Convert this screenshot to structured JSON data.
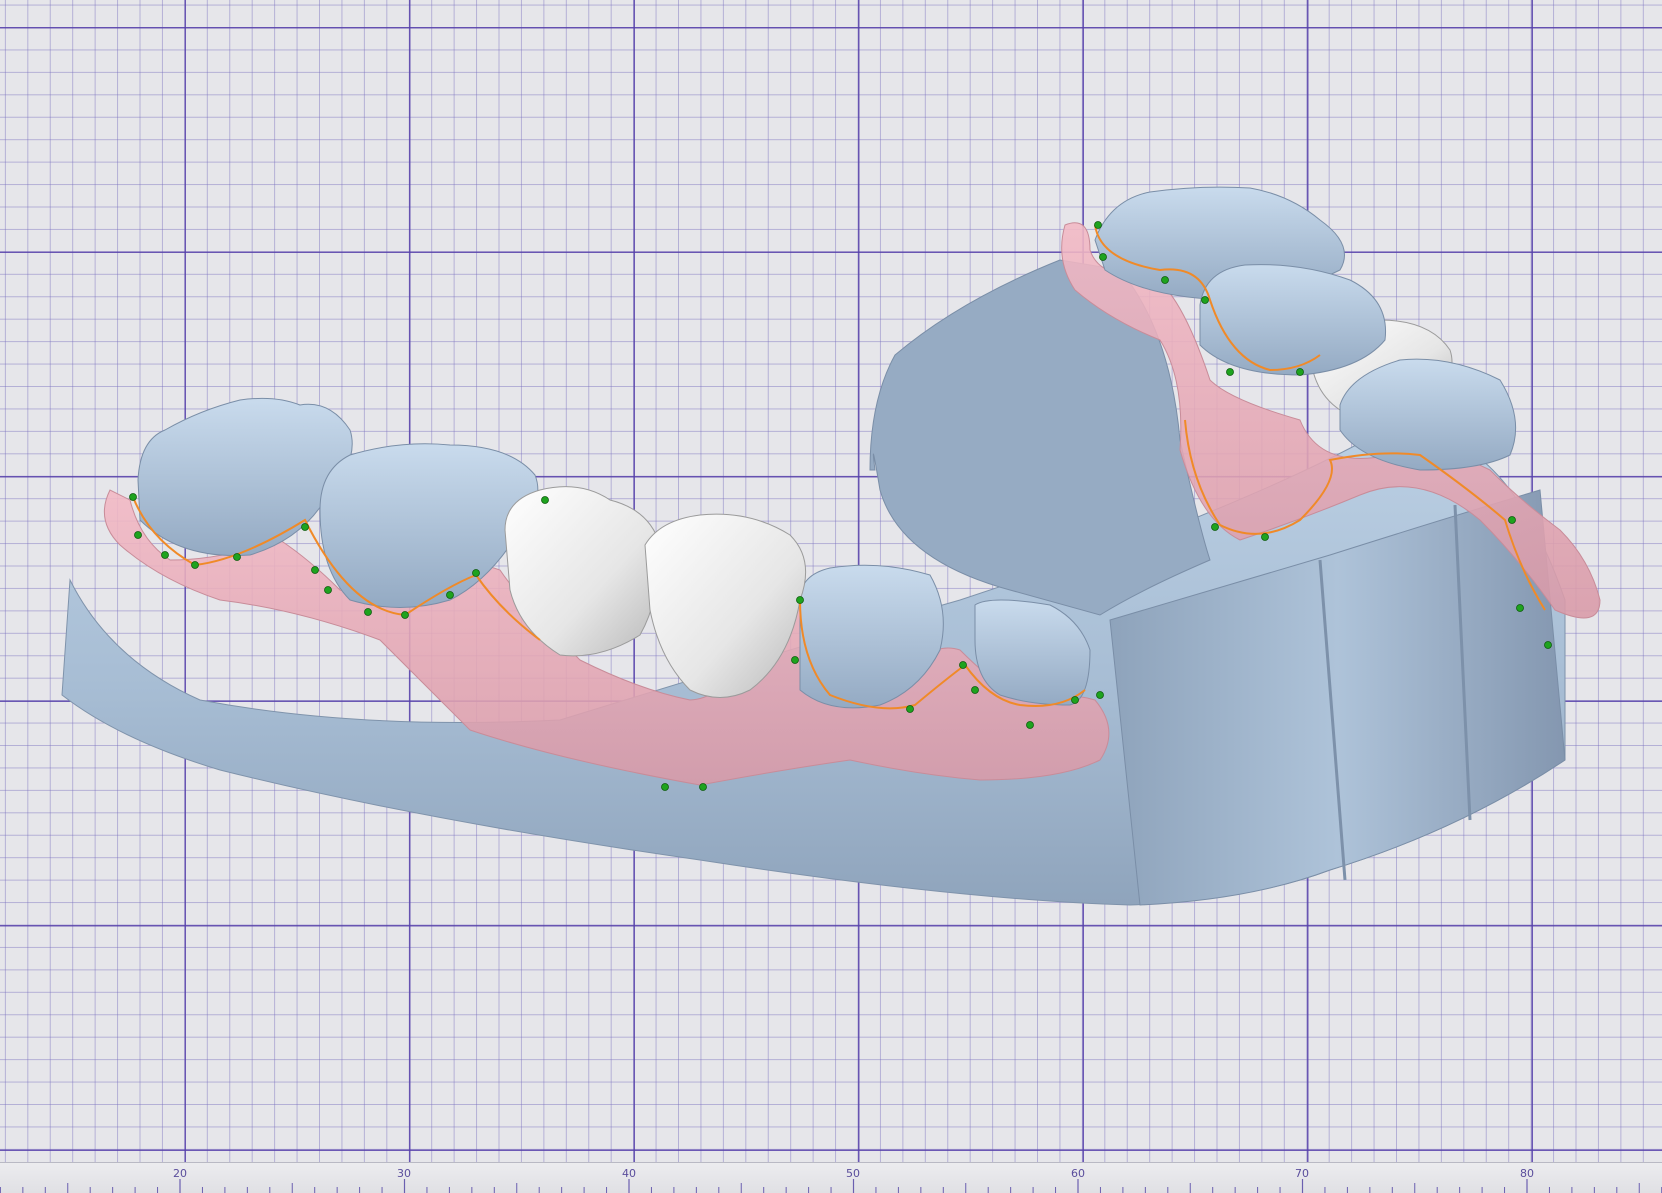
{
  "viewport": {
    "grid_color": "#5a40aa",
    "background": "#e6e6ea"
  },
  "model": {
    "colors": {
      "stone_model": "#a9bfd6",
      "stone_shadow": "#7f93ab",
      "crown_white": "#f1f1f1",
      "gingiva_pink": "#e7a6b4",
      "margin_line": "#f08a28",
      "control_point": "#1ea31e"
    },
    "icons": [
      "dental-model",
      "crown",
      "gingiva-mask",
      "margin-line",
      "control-point"
    ]
  },
  "ruler": {
    "labels": [
      "20",
      "30",
      "40",
      "50",
      "60",
      "70",
      "80"
    ]
  }
}
